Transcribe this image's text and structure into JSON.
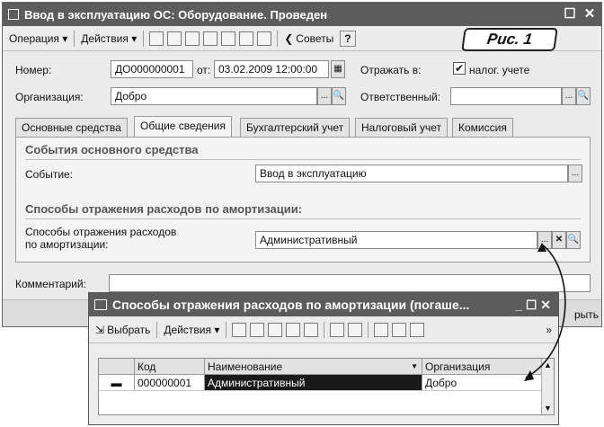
{
  "main_window": {
    "title": "Ввод в эксплуатацию ОС: Оборудование. Проведен",
    "minimize": "_",
    "close": "☐ ✕",
    "toolbar": {
      "operation": "Операция ▾",
      "actions": "Действия ▾",
      "tips": "Советы",
      "help": "?"
    },
    "badge": "Рис. 1",
    "form": {
      "number_label": "Номер:",
      "number_value": "ДО000000001",
      "from_label": "от:",
      "date_value": "03.02.2009 12:00:00",
      "reflect_label": "Отражать в:",
      "tax_label": "налог. учете",
      "org_label": "Организация:",
      "org_value": "Добро",
      "resp_label": "Ответственный:",
      "resp_value": ""
    },
    "tabs": [
      "Основные средства",
      "Общие сведения",
      "Бухгалтерский учет",
      "Налоговый учет",
      "Комиссия"
    ],
    "panel": {
      "events_title": "События основного средства",
      "event_label": "Событие:",
      "event_value": "Ввод в эксплуатацию",
      "methods_title": "Способы отражения расходов по амортизации:",
      "methods_label_1": "Способы отражения расходов",
      "methods_label_2": "по амортизации:",
      "methods_value": "Административный"
    },
    "comment_label": "Комментарий:",
    "comment_value": "",
    "close_button_partial": "рыть"
  },
  "sub_window": {
    "title": "Способы отражения расходов по амортизации (погаше...",
    "controls": "_ ☐ ✕",
    "toolbar": {
      "select": "Выбрать",
      "actions": "Действия ▾",
      "more": "»"
    },
    "table": {
      "columns": [
        "Код",
        "Наименование",
        "Организация"
      ],
      "rows": [
        {
          "code": "000000001",
          "name": "Административный",
          "org": "Добро"
        }
      ]
    }
  },
  "colors": {
    "titlebar": "#5c5c5c",
    "selected_cell": "#1a1a1a",
    "window_bg": "#ebebeb"
  }
}
